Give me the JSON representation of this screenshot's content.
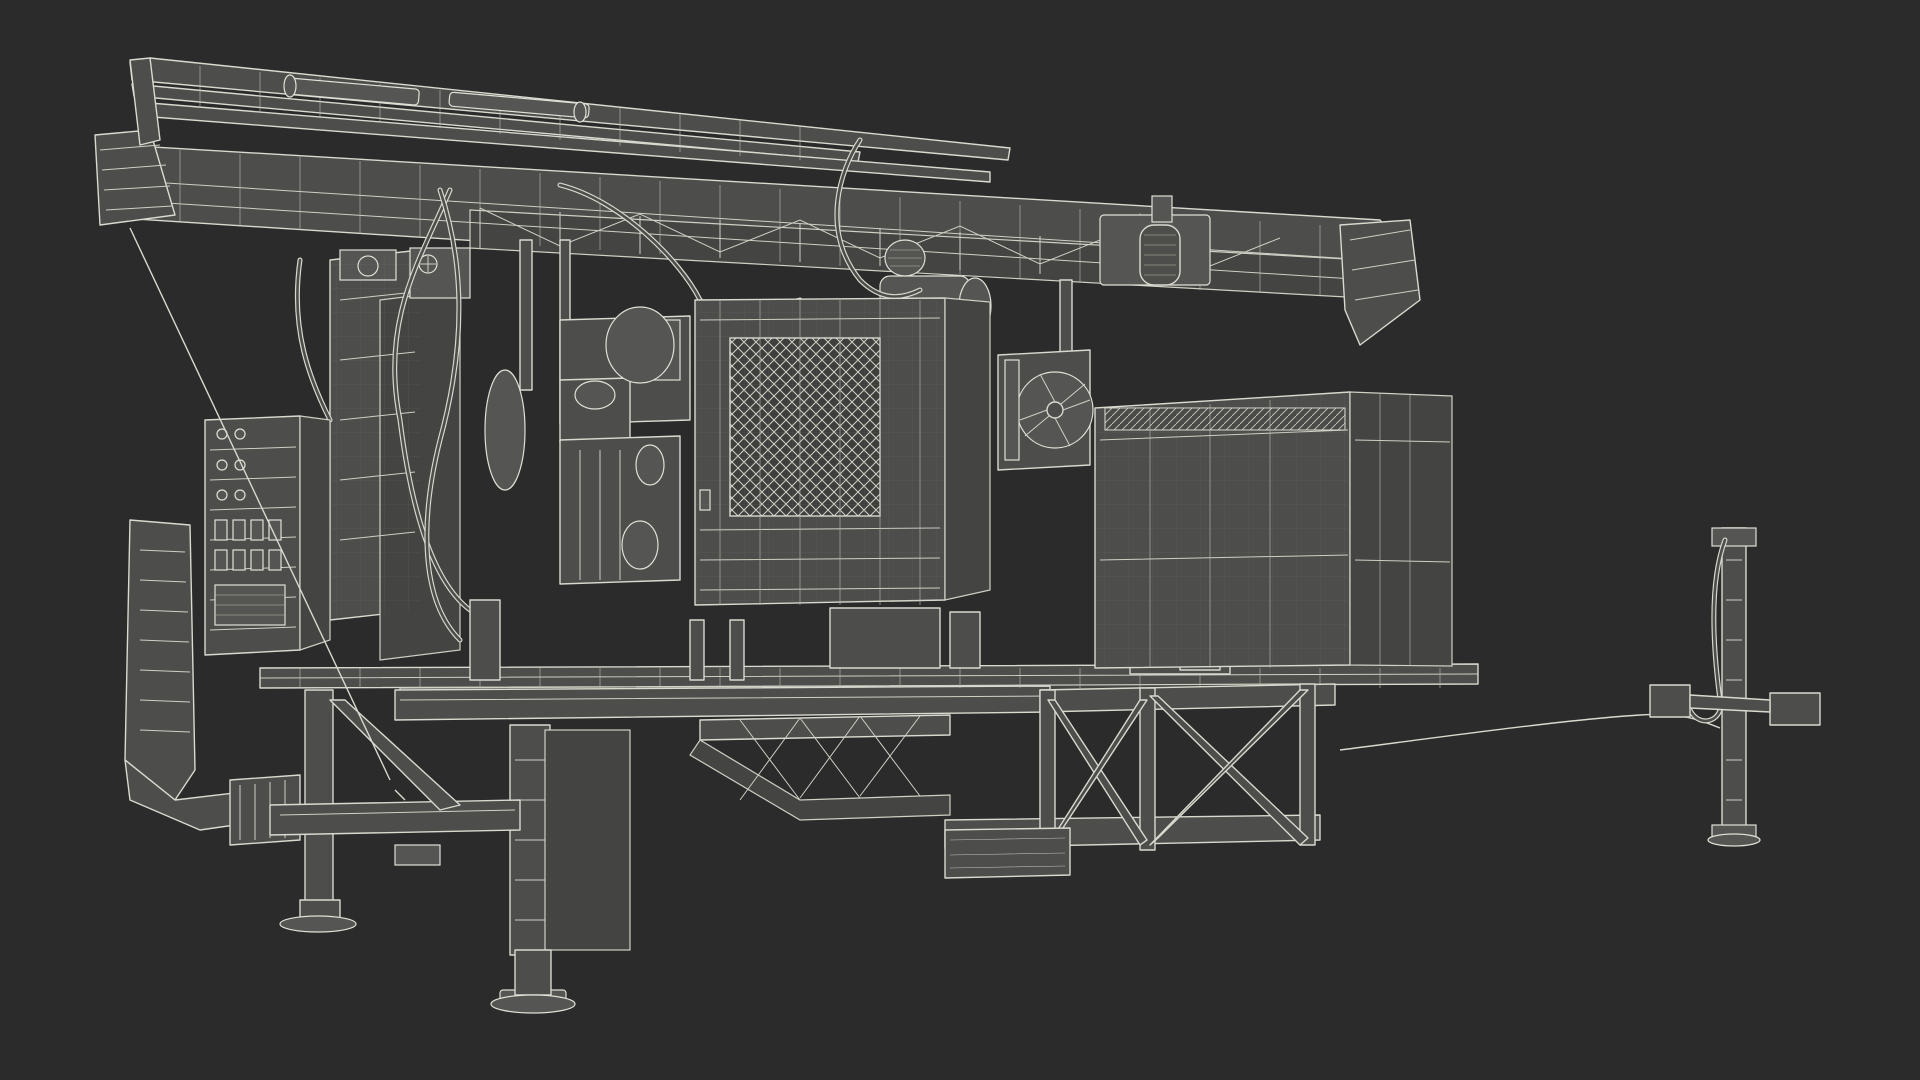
{
  "scene": {
    "subject": "mobile-drilling-rig-wireframe",
    "background_color": "#2b2b2b",
    "wire_color": "#d9d9cf",
    "surface_color": "#4d4d4b"
  }
}
